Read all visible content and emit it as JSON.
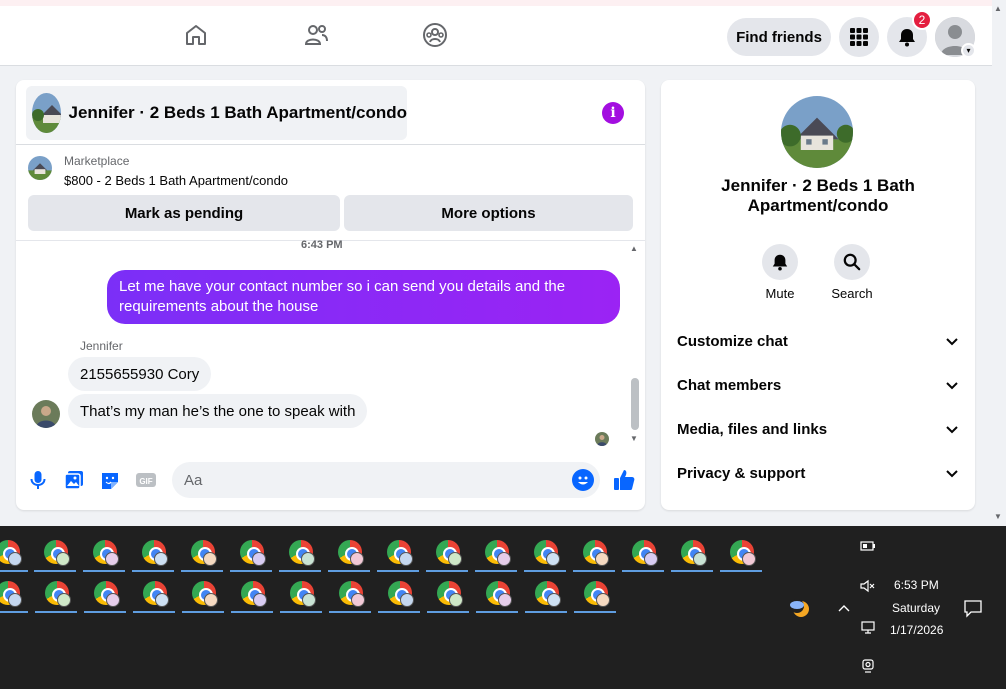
{
  "topbar": {
    "find_friends": "Find friends",
    "notification_count": "2"
  },
  "chat": {
    "title": "Jennifer · 2 Beds 1 Bath Apartment/condo",
    "marketplace_label": "Marketplace",
    "listing": "$800 - 2 Beds 1 Bath Apartment/condo",
    "mark_pending": "Mark as pending",
    "more_options": "More options",
    "time_separator": "6:43 PM",
    "messages": [
      {
        "from": "me",
        "text": "Let me have your contact number so i can send you details and the requirements about the house"
      },
      {
        "from": "Jennifer",
        "sender_label": "Jennifer",
        "text": "2155655930 Cory"
      },
      {
        "from": "Jennifer",
        "text": "That’s my man he’s the one to speak with"
      }
    ],
    "composer_placeholder": "Aa"
  },
  "info_panel": {
    "title": "Jennifer · 2 Beds 1 Bath Apartment/condo",
    "mute": "Mute",
    "search": "Search",
    "sections": [
      "Customize chat",
      "Chat members",
      "Media, files and links",
      "Privacy & support"
    ]
  },
  "taskbar": {
    "time": "6:53 PM",
    "day": "Saturday",
    "date": "1/17/2026"
  },
  "colors": {
    "accent": "#0866ff",
    "bubble_out": "#8a2be2",
    "info_icon": "#a30ee0",
    "badge": "#e41e3f"
  }
}
